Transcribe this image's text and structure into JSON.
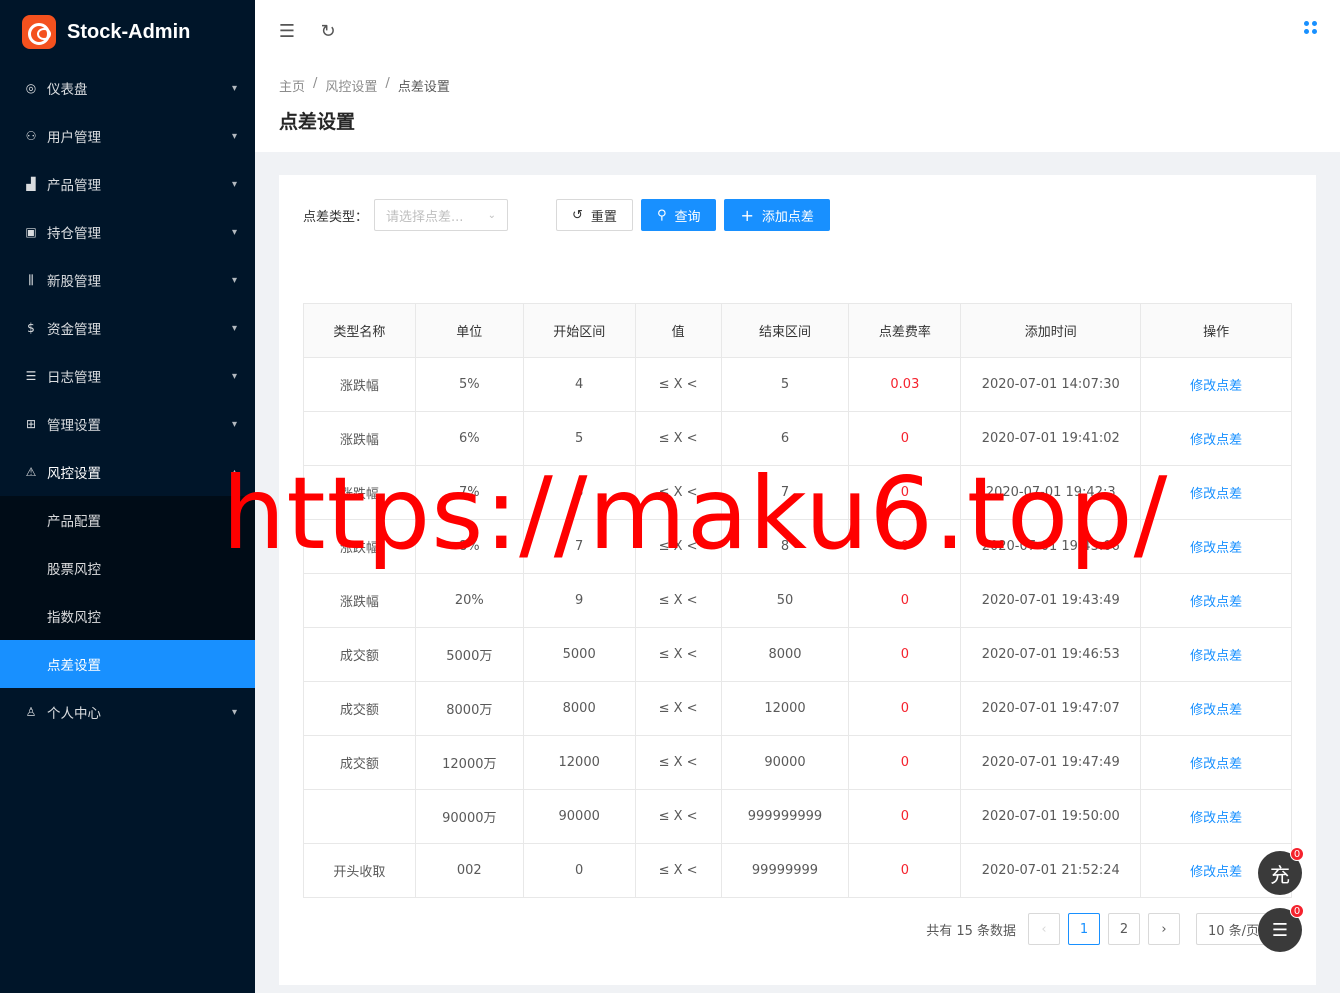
{
  "app": {
    "name": "Stock-Admin"
  },
  "sidebar": {
    "items": [
      {
        "label": "仪表盘",
        "icon": "dashboard-icon"
      },
      {
        "label": "用户管理",
        "icon": "user-group-icon"
      },
      {
        "label": "产品管理",
        "icon": "chart-icon"
      },
      {
        "label": "持仓管理",
        "icon": "position-icon"
      },
      {
        "label": "新股管理",
        "icon": "stock-icon"
      },
      {
        "label": "资金管理",
        "icon": "money-icon"
      },
      {
        "label": "日志管理",
        "icon": "log-icon"
      },
      {
        "label": "管理设置",
        "icon": "settings-icon"
      },
      {
        "label": "风控设置",
        "icon": "warning-icon"
      }
    ],
    "submenu": [
      {
        "label": "产品配置"
      },
      {
        "label": "股票风控"
      },
      {
        "label": "指数风控"
      },
      {
        "label": "点差设置"
      }
    ],
    "last": {
      "label": "个人中心",
      "icon": "user-icon"
    }
  },
  "breadcrumb": [
    "主页",
    "风控设置",
    "点差设置"
  ],
  "page": {
    "title": "点差设置"
  },
  "filter": {
    "label": "点差类型：",
    "placeholder": "请选择点差...",
    "reset": "重置",
    "query": "查询",
    "add": "添加点差"
  },
  "table": {
    "headers": [
      "类型名称",
      "单位",
      "开始区间",
      "值",
      "结束区间",
      "点差费率",
      "添加时间",
      "操作"
    ],
    "rows": [
      [
        "涨跌幅",
        "5%",
        "4",
        "≤ X <",
        "5",
        "0.03",
        "2020-07-01 14:07:30",
        "修改点差"
      ],
      [
        "涨跌幅",
        "6%",
        "5",
        "≤ X <",
        "6",
        "0",
        "2020-07-01 19:41:02",
        "修改点差"
      ],
      [
        "涨跌幅",
        "7%",
        "6",
        "≤ X <",
        "7",
        "0",
        "2020-07-01 19:42:3",
        "修改点差"
      ],
      [
        "涨跌幅",
        "8%",
        "7",
        "≤ X <",
        "8",
        "0",
        "2020-07-01 19:43:06",
        "修改点差"
      ],
      [
        "涨跌幅",
        "20%",
        "9",
        "≤ X <",
        "50",
        "0",
        "2020-07-01 19:43:49",
        "修改点差"
      ],
      [
        "成交额",
        "5000万",
        "5000",
        "≤ X <",
        "8000",
        "0",
        "2020-07-01 19:46:53",
        "修改点差"
      ],
      [
        "成交额",
        "8000万",
        "8000",
        "≤ X <",
        "12000",
        "0",
        "2020-07-01 19:47:07",
        "修改点差"
      ],
      [
        "成交额",
        "12000万",
        "12000",
        "≤ X <",
        "90000",
        "0",
        "2020-07-01 19:47:49",
        "修改点差"
      ],
      [
        "",
        "90000万",
        "90000",
        "≤ X <",
        "999999999",
        "0",
        "2020-07-01 19:50:00",
        "修改点差"
      ],
      [
        "开头收取",
        "002",
        "0",
        "≤ X <",
        "99999999",
        "0",
        "2020-07-01 21:52:24",
        "修改点差"
      ]
    ]
  },
  "pager": {
    "total_text": "共有 15 条数据",
    "pages": [
      "1",
      "2"
    ],
    "current": "1",
    "page_size": "10 条/页"
  },
  "floats": {
    "charge": {
      "label": "充",
      "badge": "0"
    },
    "user": {
      "badge": "0"
    }
  },
  "watermark": "https://maku6.top/",
  "colors": {
    "sidebar_bg": "#001529",
    "accent": "#1890ff",
    "danger": "#f5222d"
  }
}
